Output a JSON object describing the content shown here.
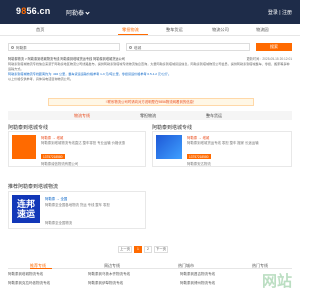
{
  "header": {
    "logo_part1": "9",
    "logo_part2": "8",
    "logo_part3": "5",
    "logo_part4": "6.cn",
    "city": "阿勒泰",
    "login": "登录 | 注册"
  },
  "nav": {
    "tabs": [
      "首页",
      "零担物流",
      "整车货运",
      "物流公司",
      "物流园"
    ]
  },
  "search": {
    "from_value": "阿勒泰",
    "to_value": "塔城",
    "button": "搜索"
  },
  "crumbs": {
    "left": "阿勒泰物流 > 阿勒泰到塔城物流专线 阿勒泰到塔城货运专线 阿勒泰到塔城货运公司",
    "right": "更新时间：2025-05-15 20:12:01"
  },
  "intro": {
    "p1": "阿勒泰到塔城物流专线信息来源于阿勒泰地区物流公司线路发布，提供阿勒泰到塔城专线物流信息查询，大量阿勒泰到塔城货运信息，阿勒泰到塔城物流公司会员，提供阿勒泰到塔城整车、零担、搬家等多种运输方式。",
    "p2": "阿勒泰到塔城物流专线距离约为: 492 公里，整车货运运输价格参考 1-3 元/吨公里，零担货运价格参考 0.5-1.2 元/公斤。",
    "p3": "以上价格仅供参考，具体请电话咨询物流公司。"
  },
  "notice": "!  联系物流公司时请向对方说明是在9856物流网看到的信息！",
  "filter_tabs": [
    "物流专线",
    "零担物流",
    "整车货运"
  ],
  "sections": {
    "special_line": "阿勒泰到塔城专线",
    "special_line_2": "阿勒泰到塔城专线",
    "recommended": "推荐阿勒泰到塔城物流"
  },
  "cards": [
    {
      "route_from": "阿勒泰",
      "route_to": "塔城",
      "desc": "阿勒泰到塔城物流专线直达 整车零担 专业运输 价格优惠",
      "phone": "13757218580",
      "company": "阿勒泰诚信物流有限公司"
    },
    {
      "route_from": "阿勒泰",
      "route_to": "塔城",
      "desc": "阿勒泰到塔城货运专线 零担 整车 搬家 长途运输",
      "phone": "13757218580",
      "company": "阿勒泰安达物流"
    },
    {
      "route_from": "阿勒泰",
      "route_to": "全国",
      "desc": "阿勒泰至全国各地物流 货运 专线 整车 零担",
      "company": "阿勒泰至全国物流",
      "thumb_line1": "连邦",
      "thumb_line2": "速运"
    }
  ],
  "pager": [
    "上一页",
    "1",
    "2",
    "下一页"
  ],
  "bottom_tabs": [
    "推荐专线",
    "周边专线",
    "热门城市",
    "热门专线"
  ],
  "bottom_links": [
    "阿勒泰到塔城物流专线",
    "阿勒泰到乌鲁木齐物流专线",
    "阿勒泰到昌吉物流专线",
    "阿勒泰到克拉玛依物流专线",
    "阿勒泰到伊犁物流专线",
    "阿勒泰到博州物流专线"
  ],
  "watermark": "网站",
  "colors": {
    "accent": "#ff6a00",
    "topbar": "#1e2c49",
    "notice": "#e94b1b"
  }
}
